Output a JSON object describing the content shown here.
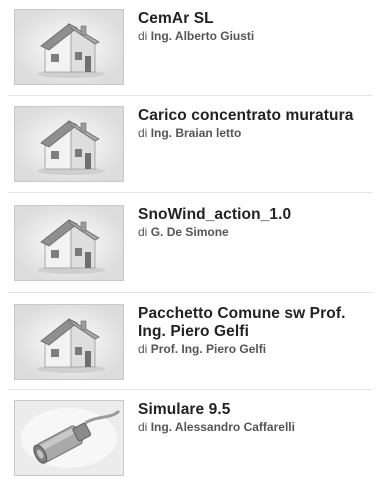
{
  "items": [
    {
      "title": "CemAr SL",
      "by": "di",
      "author": "Ing. Alberto Giusti",
      "icon": "house-icon"
    },
    {
      "title": "Carico concentrato muratura",
      "by": "di",
      "author": "Ing. Braian letto",
      "icon": "house-icon"
    },
    {
      "title": "SnoWind_action_1.0",
      "by": "di",
      "author": "G. De Simone",
      "icon": "house-icon"
    },
    {
      "title": "Pacchetto Comune sw Prof. Ing. Piero Gelfi",
      "by": "di",
      "author": "Prof. Ing. Piero Gelfi",
      "icon": "house-icon"
    },
    {
      "title": "Simulare 9.5",
      "by": "di",
      "author": "Ing. Alessandro Caffarelli",
      "icon": "sensor-probe-icon"
    }
  ]
}
